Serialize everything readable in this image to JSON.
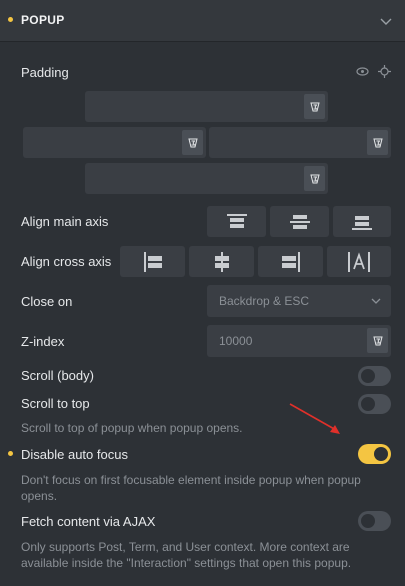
{
  "header": {
    "title": "POPUP"
  },
  "padding": {
    "label": "Padding",
    "unit_icon": "units-3-icon"
  },
  "align_main": {
    "label": "Align main axis"
  },
  "align_cross": {
    "label": "Align cross axis"
  },
  "close_on": {
    "label": "Close on",
    "value": "Backdrop & ESC"
  },
  "zindex": {
    "label": "Z-index",
    "placeholder": "10000"
  },
  "scroll_body": {
    "label": "Scroll (body)",
    "enabled": false
  },
  "scroll_top": {
    "label": "Scroll to top",
    "description": "Scroll to top of popup when popup opens.",
    "enabled": false
  },
  "disable_focus": {
    "label": "Disable auto focus",
    "description_line1": "Don't focus on first focusable element inside popup when popup",
    "description_line2": "opens.",
    "enabled": true
  },
  "fetch_ajax": {
    "label": "Fetch content via AJAX",
    "description_line1": "Only supports Post, Term, and User context. More context are",
    "description_line2": "available inside the \"Interaction\" settings that open this popup.",
    "enabled": false
  },
  "colors": {
    "accent": "#f4c542",
    "annotation_arrow": "#e0302a"
  }
}
